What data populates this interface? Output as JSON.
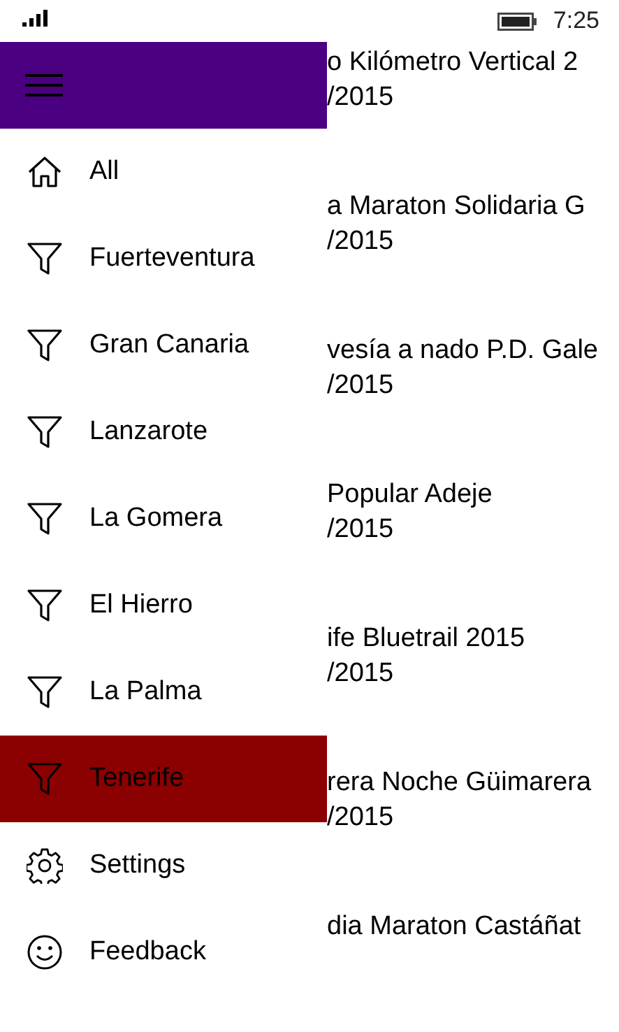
{
  "status_bar": {
    "time": "7:25"
  },
  "menu": {
    "items": [
      {
        "label": "All",
        "kind": "home",
        "selected": false
      },
      {
        "label": "Fuerteventura",
        "kind": "filter",
        "selected": false
      },
      {
        "label": "Gran Canaria",
        "kind": "filter",
        "selected": false
      },
      {
        "label": "Lanzarote",
        "kind": "filter",
        "selected": false
      },
      {
        "label": "La Gomera",
        "kind": "filter",
        "selected": false
      },
      {
        "label": "El Hierro",
        "kind": "filter",
        "selected": false
      },
      {
        "label": "La Palma",
        "kind": "filter",
        "selected": false
      },
      {
        "label": "Tenerife",
        "kind": "filter",
        "selected": true
      },
      {
        "label": "Settings",
        "kind": "settings",
        "selected": false
      },
      {
        "label": "Feedback",
        "kind": "feedback",
        "selected": false
      }
    ]
  },
  "events": [
    {
      "title": "o Kilómetro Vertical 2",
      "date": "/2015"
    },
    {
      "title": "a Maraton Solidaria G",
      "date": "/2015"
    },
    {
      "title": "vesía a nado P.D. Gale",
      "date": "/2015"
    },
    {
      "title": "Popular Adeje",
      "date": "/2015"
    },
    {
      "title": "ife Bluetrail 2015",
      "date": "/2015"
    },
    {
      "title": "rera Noche Güimarera",
      "date": "/2015"
    },
    {
      "title": "dia Maraton Castáñat"
    }
  ]
}
